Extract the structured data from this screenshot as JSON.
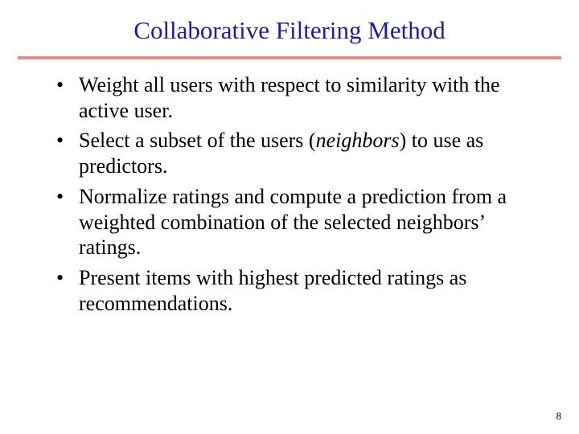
{
  "title": "Collaborative Filtering Method",
  "bullets": [
    {
      "pre": "Weight all users with respect to similarity with the active user.",
      "ital": "",
      "post": ""
    },
    {
      "pre": "Select a subset of the users (",
      "ital": "neighbors",
      "post": ") to use as predictors."
    },
    {
      "pre": "Normalize ratings and compute a prediction from a weighted combination of the selected neighbors’ ratings.",
      "ital": "",
      "post": ""
    },
    {
      "pre": "Present items with highest predicted ratings as recommendations.",
      "ital": "",
      "post": ""
    }
  ],
  "page_number": "8"
}
